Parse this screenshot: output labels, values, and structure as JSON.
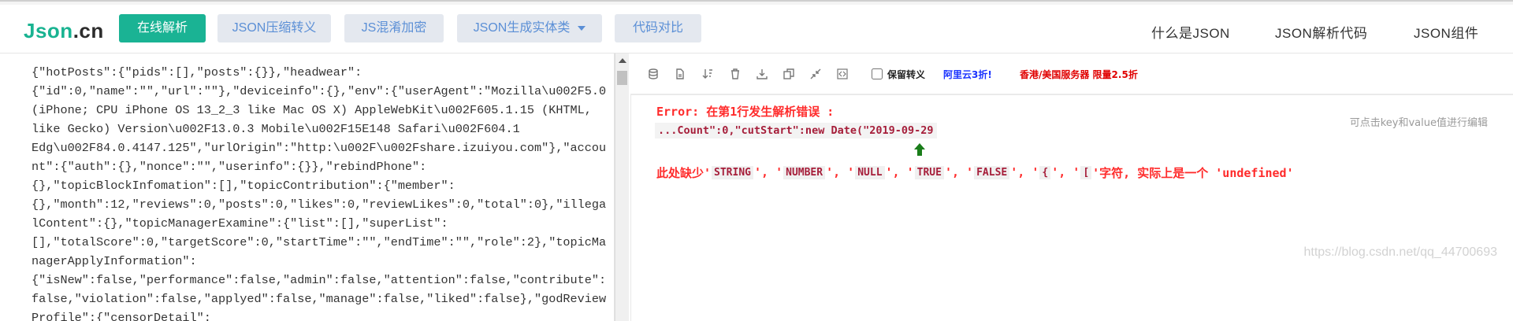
{
  "brand": {
    "part1": "Json",
    "part2": ".cn"
  },
  "nav": {
    "online_parse": "在线解析",
    "json_compress": "JSON压缩转义",
    "js_obfuscate": "JS混淆加密",
    "json_entity": "JSON生成实体类",
    "code_diff": "代码对比"
  },
  "right_links": {
    "what_is_json": "什么是JSON",
    "json_parse_code": "JSON解析代码",
    "json_component": "JSON组件"
  },
  "editor": {
    "lines": [
      "{\"hotPosts\":{\"pids\":[],\"posts\":{}},\"headwear\":",
      "{\"id\":0,\"name\":\"\",\"url\":\"\"},\"deviceinfo\":{},\"env\":{\"userAgent\":\"Mozilla\\u002F5.0",
      "(iPhone; CPU iPhone OS 13_2_3 like Mac OS X) AppleWebKit\\u002F605.1.15 (KHTML,",
      "like Gecko) Version\\u002F13.0.3 Mobile\\u002F15E148 Safari\\u002F604.1",
      "Edg\\u002F84.0.4147.125\",\"urlOrigin\":\"http:\\u002F\\u002Fshare.izuiyou.com\"},\"accou",
      "nt\":{\"auth\":{},\"nonce\":\"\",\"userinfo\":{}},\"rebindPhone\":",
      "{},\"topicBlockInfomation\":[],\"topicContribution\":{\"member\":",
      "{},\"month\":12,\"reviews\":0,\"posts\":0,\"likes\":0,\"reviewLikes\":0,\"total\":0},\"illega",
      "lContent\":{},\"topicManagerExamine\":{\"list\":[],\"superList\":",
      "[],\"totalScore\":0,\"targetScore\":0,\"startTime\":\"\",\"endTime\":\"\",\"role\":2},\"topicMa",
      "nagerApplyInformation\":",
      "{\"isNew\":false,\"performance\":false,\"admin\":false,\"attention\":false,\"contribute\":",
      "false,\"violation\":false,\"applyed\":false,\"manage\":false,\"liked\":false},\"godReview",
      "Profile\":{\"censorDetail\":"
    ]
  },
  "toolbar": {
    "keep_escape_label": "保留转义",
    "promo_aliyun": "阿里云3折!",
    "promo_hk": "香港/美国服务器 限量2.5折",
    "icons": [
      "database-icon",
      "file-icon",
      "sort-icon",
      "trash-icon",
      "download-icon",
      "copy-icon",
      "compress-icon",
      "code-icon"
    ]
  },
  "output": {
    "error_title": "Error: 在第1行发生解析错误 :",
    "error_snippet": "...Count\":0,\"cutStart\":new Date(\"2019-09-29",
    "msg_prefix": "此处缺少'",
    "tokens": [
      "STRING",
      "NUMBER",
      "NULL",
      "TRUE",
      "FALSE",
      "{",
      "["
    ],
    "msg_suffix": "'字符, 实际上是一个 'undefined'",
    "hint": "可点击key和value值进行编辑",
    "arrow_color": "#1a7d1a"
  },
  "watermark": "https://blog.csdn.net/qq_44700693",
  "colors": {
    "accent": "#1ab394",
    "error": "#ff2b2b",
    "link_blue": "#5b8fd6"
  }
}
